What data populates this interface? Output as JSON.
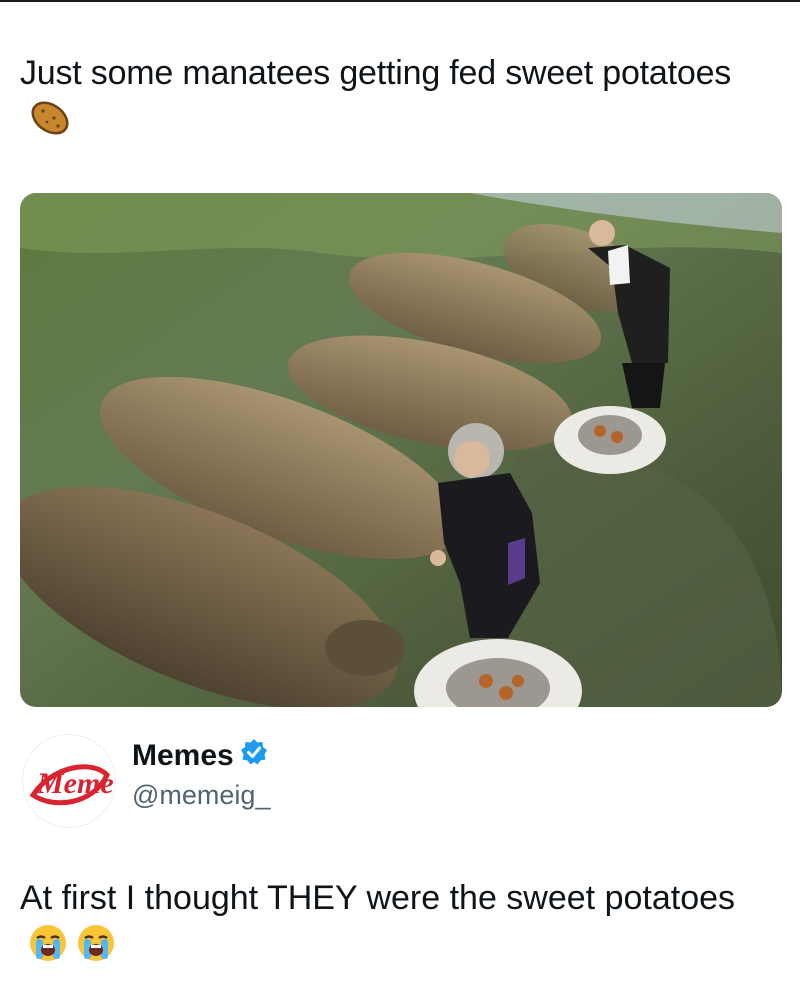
{
  "post": {
    "text": "Just some manatees getting fed sweet potatoes",
    "emoji": "potato-emoji"
  },
  "account": {
    "name": "Memes",
    "handle": "@memeig_",
    "verified": true,
    "avatar_text": "Meme"
  },
  "reply": {
    "text": "At first I thought THEY were the sweet potatoes",
    "emojis": [
      "loudly-crying-face-emoji",
      "loudly-crying-face-emoji"
    ]
  },
  "colors": {
    "verified_badge": "#1d9bf0",
    "handle_gray": "#536471",
    "text": "#0f1419"
  }
}
